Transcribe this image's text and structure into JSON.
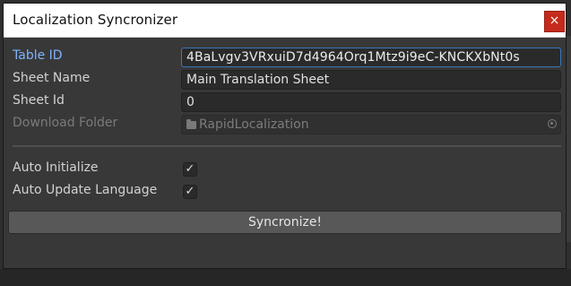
{
  "window": {
    "title": "Localization Syncronizer",
    "close_glyph": "×"
  },
  "form": {
    "table_id": {
      "label": "Table ID",
      "value": "4BaLvgv3VRxuiD7d4964Orq1Mtz9i9eC-KNCKXbNt0s"
    },
    "sheet_name": {
      "label": "Sheet Name",
      "value": "Main Translation Sheet"
    },
    "sheet_id": {
      "label": "Sheet Id",
      "value": "0"
    },
    "download_folder": {
      "label": "Download Folder",
      "value": "RapidLocalization",
      "icon": "folder-icon",
      "picker_icon": "object-picker-icon"
    },
    "auto_initialize": {
      "label": "Auto Initialize",
      "checked": true,
      "glyph": "✓"
    },
    "auto_update_language": {
      "label": "Auto Update Language",
      "checked": true,
      "glyph": "✓"
    }
  },
  "actions": {
    "sync_label": "Syncronize!"
  },
  "colors": {
    "accent_label": "#80b3ff",
    "close_button": "#c42b1c",
    "focus_border": "#3a79bb"
  }
}
